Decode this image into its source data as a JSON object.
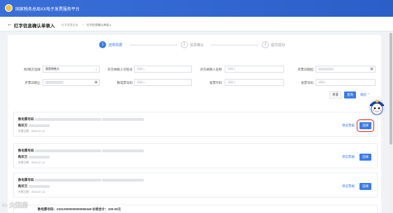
{
  "header": {
    "site_title": "国家税务总局XX电子发票服务平台"
  },
  "subheader": {
    "back_icon": "arrow-left-icon",
    "page_title": "红字信息确认单录入",
    "breadcrumb": [
      "红字发票业务",
      ">",
      "红字信息确认单录入"
    ]
  },
  "steps": [
    {
      "number": "1",
      "label": "选择票据",
      "active": true
    },
    {
      "number": "2",
      "label": "信息确认",
      "active": false
    },
    {
      "number": "3",
      "label": "提交成功",
      "active": false
    }
  ],
  "filters": {
    "role": {
      "label": "购/销方选择",
      "value": "我是销售方"
    },
    "buyer_tax_id": {
      "label": "对方纳税人识别号",
      "placeholder": "请输入"
    },
    "buyer_name": {
      "label": "对方纳税人名称",
      "placeholder": "请输入"
    },
    "date_start": {
      "label": "开票日期起"
    },
    "date_end": {
      "label": "开票日期止"
    },
    "digital_invoice_no": {
      "label": "数电票号码",
      "placeholder": "请输入"
    },
    "invoice_code": {
      "label": "发票代码",
      "placeholder": "请输入"
    },
    "invoice_no": {
      "label": "发票号码",
      "placeholder": "请输入"
    },
    "reset_label": "重置",
    "query_label": "查询",
    "collapse_label": "收起"
  },
  "results": [
    {
      "line1_label": "数电票号码",
      "line2_label": "购买方",
      "date_text": "开票日期：2023-07-12",
      "preview_label": "预览票据",
      "select_label": "选择",
      "highlighted": true
    },
    {
      "line1_label": "数电票号码",
      "line2_label": "购买方",
      "date_text": "开票日期：2023-07-12",
      "preview_label": "预览票据",
      "select_label": "选择",
      "highlighted": false
    },
    {
      "line1_label": "数电票号码",
      "line2_label": "购买方",
      "date_text": "开票日期：2023-07-13",
      "preview_label": "预览票据",
      "select_label": "选择",
      "highlighted": false
    }
  ],
  "partial_row": {
    "text": "数电票号码：23312000000000065349  价税合计：100.00元"
  },
  "watermark": "大账房"
}
